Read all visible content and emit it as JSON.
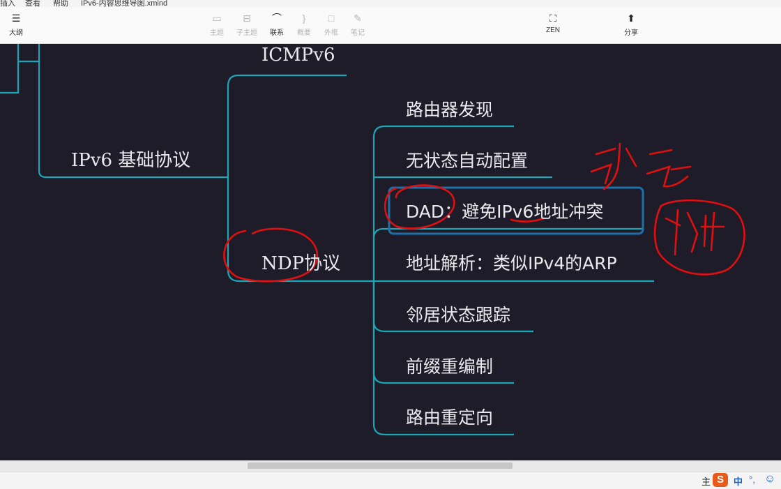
{
  "menubar": {
    "insert": "插入",
    "view": "查看",
    "help": "帮助",
    "file_title": "IPv6-内容思维导图.xmind"
  },
  "toolbar": {
    "outline": "大纲",
    "topic": "主题",
    "subtopic": "子主题",
    "relationship": "联系",
    "summary": "概要",
    "boundary": "外框",
    "notes": "笔记",
    "zen": "ZEN",
    "share": "分享"
  },
  "mindmap": {
    "icmpv6": "ICMPv6",
    "ipv6_basic": "IPv6 基础协议",
    "ndp": "NDP协议",
    "children": [
      "路由器发现",
      "无状态自动配置",
      "DAD：避免IPv6地址冲突",
      "地址解析：类似IPv4的ARP",
      "邻居状态跟踪",
      "前缀重编制",
      "路由重定向"
    ]
  },
  "ime": {
    "brand": "S",
    "lang": "中",
    "punct": "°,",
    "emoji": "☺"
  },
  "status": {
    "label": "主"
  },
  "colors": {
    "line": "#1aa6b7",
    "annotation": "#e01010",
    "highlight": "#1f6fa8",
    "canvas": "#1e1c28"
  }
}
